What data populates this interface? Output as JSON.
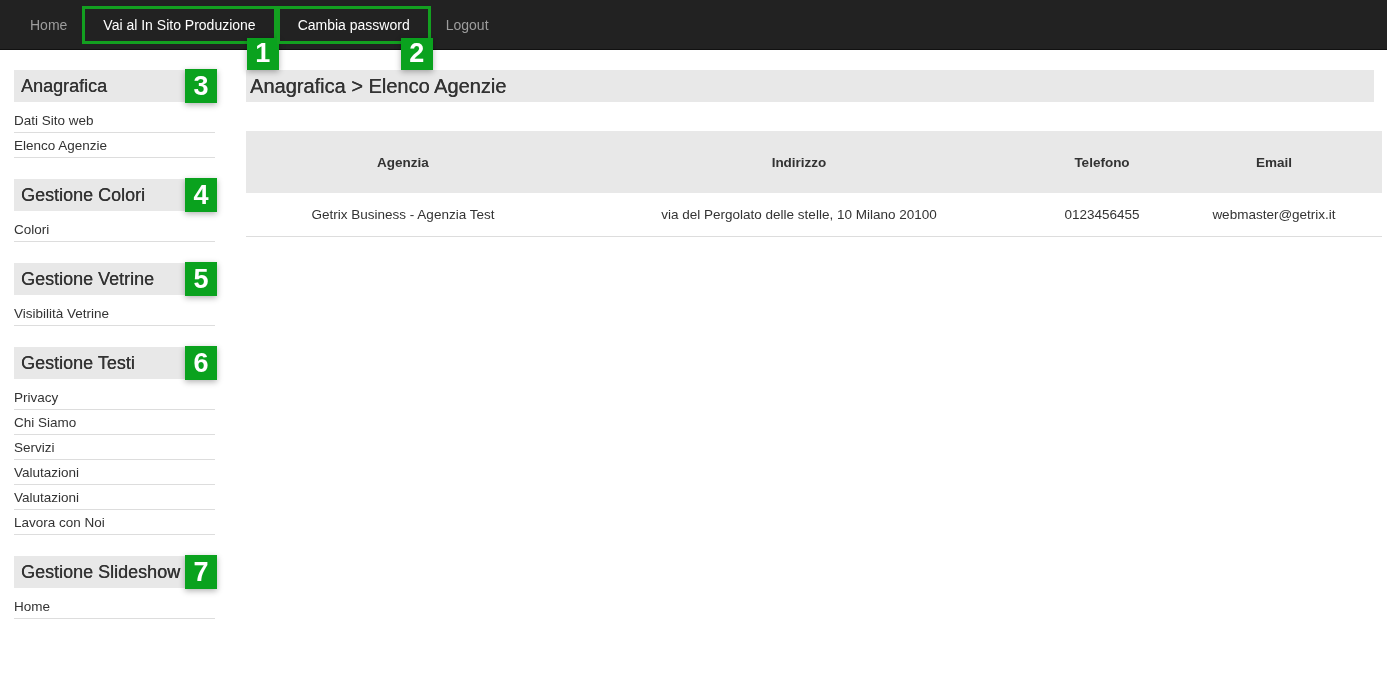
{
  "navbar": {
    "items": [
      {
        "label": "Home",
        "highlighted": false
      },
      {
        "label": "Vai al In Sito Produzione",
        "highlighted": true,
        "callout": "1"
      },
      {
        "label": "Cambia password",
        "highlighted": true,
        "callout": "2"
      },
      {
        "label": "Logout",
        "highlighted": false
      }
    ]
  },
  "sidebar": {
    "sections": [
      {
        "title": "Anagrafica",
        "callout": "3",
        "items": [
          "Dati Sito web",
          "Elenco Agenzie"
        ]
      },
      {
        "title": "Gestione Colori",
        "callout": "4",
        "items": [
          "Colori"
        ]
      },
      {
        "title": "Gestione Vetrine",
        "callout": "5",
        "items": [
          "Visibilità Vetrine"
        ]
      },
      {
        "title": "Gestione Testi",
        "callout": "6",
        "items": [
          "Privacy",
          "Chi Siamo",
          "Servizi",
          "Valutazioni",
          "Valutazioni",
          "Lavora con Noi"
        ]
      },
      {
        "title": "Gestione Slideshow",
        "callout": "7",
        "items": [
          "Home"
        ]
      }
    ]
  },
  "breadcrumb": "Anagrafica > Elenco Agenzie",
  "table": {
    "columns": [
      "Agenzia",
      "Indirizzo",
      "Telefono",
      "Email"
    ],
    "rows": [
      [
        "Getrix Business - Agenzia Test",
        "via del Pergolato delle stelle, 10 Milano 20100",
        "0123456455",
        "webmaster@getrix.it"
      ]
    ]
  }
}
